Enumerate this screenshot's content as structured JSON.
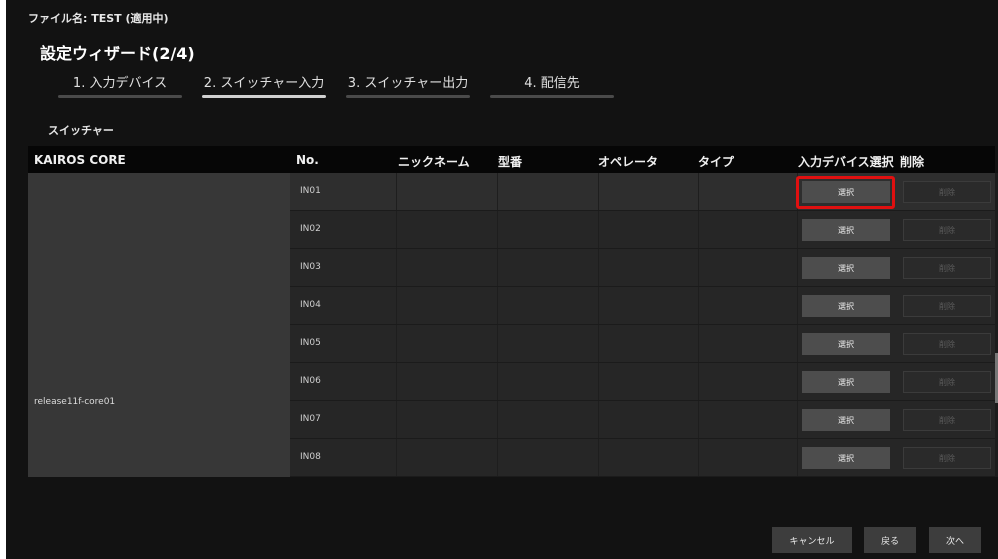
{
  "header": {
    "file_name": "ファイル名: TEST (適用中)",
    "wizard_title": "設定ウィザード(2/4)"
  },
  "steps": [
    {
      "label": "1. 入力デバイス",
      "active": false
    },
    {
      "label": "2. スイッチャー入力",
      "active": true
    },
    {
      "label": "3. スイッチャー出力",
      "active": false
    },
    {
      "label": "4. 配信先",
      "active": false
    }
  ],
  "section_label": "スイッチャー",
  "table": {
    "headers": {
      "core": "KAIROS CORE",
      "no": "No.",
      "nickname": "ニックネーム",
      "model": "型番",
      "operator": "オペレータ",
      "type": "タイプ",
      "input_device_select": "入力デバイス選択",
      "delete": "削除"
    },
    "core_name": "release11f-core01",
    "select_label": "選択",
    "delete_label": "削除",
    "rows": [
      {
        "no": "IN01",
        "selected": true
      },
      {
        "no": "IN02"
      },
      {
        "no": "IN03"
      },
      {
        "no": "IN04"
      },
      {
        "no": "IN05"
      },
      {
        "no": "IN06"
      },
      {
        "no": "IN07"
      },
      {
        "no": "IN08"
      }
    ]
  },
  "footer": {
    "cancel_label": "キャンセル",
    "back_label": "戻る",
    "next_label": "次へ"
  },
  "colors": {
    "background": "#121212",
    "core_cell": "#373737",
    "row": "#262626",
    "highlight": "#e01010"
  }
}
